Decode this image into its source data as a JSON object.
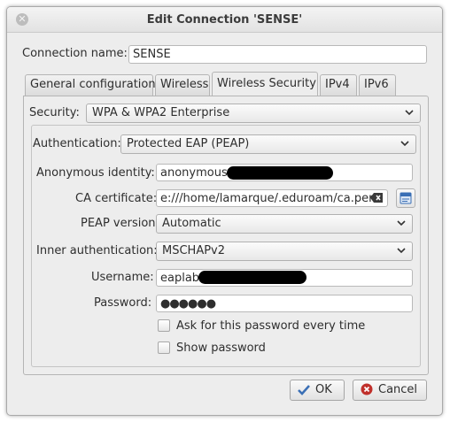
{
  "window": {
    "title": "Edit Connection 'SENSE'"
  },
  "connection_name": {
    "label": "Connection name:",
    "value": "SENSE"
  },
  "tabs": [
    {
      "label": "General configuration",
      "active": false
    },
    {
      "label": "Wireless",
      "active": false
    },
    {
      "label": "Wireless Security",
      "active": true
    },
    {
      "label": "IPv4",
      "active": false
    },
    {
      "label": "IPv6",
      "active": false
    }
  ],
  "security": {
    "label": "Security:",
    "value": "WPA & WPA2 Enterprise"
  },
  "authentication": {
    "label": "Authentication:",
    "value": "Protected EAP (PEAP)"
  },
  "form": {
    "anonymous_identity": {
      "label": "Anonymous identity:",
      "value": "anonymous@"
    },
    "ca_certificate": {
      "label": "CA certificate:",
      "value": "e:///home/lamarque/.eduroam/ca.pem"
    },
    "peap_version": {
      "label": "PEAP version:",
      "value": "Automatic"
    },
    "inner_authentication": {
      "label": "Inner authentication:",
      "value": "MSCHAPv2"
    },
    "username": {
      "label": "Username:",
      "value": "eaplab@"
    },
    "password": {
      "label": "Password:",
      "value": "●●●●●●"
    }
  },
  "options": {
    "ask_password": {
      "label": "Ask for this password every time",
      "checked": false
    },
    "show_password": {
      "label": "Show password",
      "checked": false
    }
  },
  "buttons": {
    "ok": "OK",
    "cancel": "Cancel"
  },
  "colors": {
    "ok_icon": "#3a6fb5",
    "cancel_icon": "#c0302b",
    "redaction": "#000000"
  }
}
